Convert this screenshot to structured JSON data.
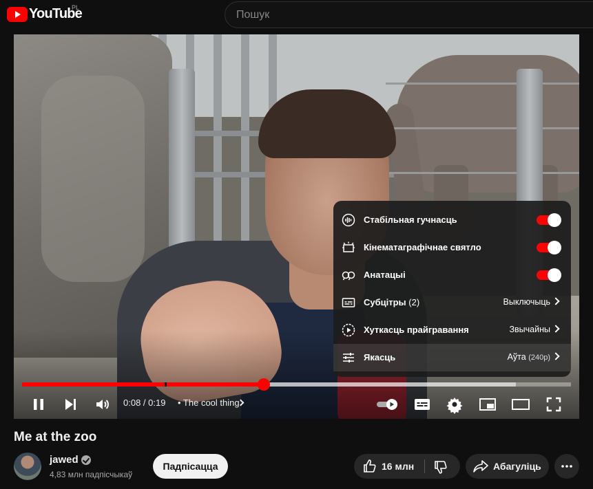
{
  "header": {
    "logo_text": "YouTube",
    "region": "PL",
    "search_placeholder": "Пошук"
  },
  "colors": {
    "accent": "#ff0000",
    "background": "#0f0f0f",
    "chip": "#272727"
  },
  "player": {
    "time_current": "0:08",
    "time_total": "0:19",
    "time_display": "0:08 / 0:19",
    "chapter": "• The cool thing",
    "progress_fraction": 0.44,
    "buffered_fraction": 0.9,
    "settings": {
      "items": [
        {
          "label": "Стабільная гучнасць",
          "type": "toggle",
          "on": true,
          "icon": "stable-volume-icon"
        },
        {
          "label": "Кінематаграфічнае святло",
          "type": "toggle",
          "on": true,
          "icon": "ambient-mode-icon"
        },
        {
          "label": "Анатацыі",
          "type": "toggle",
          "on": true,
          "icon": "annotations-icon"
        },
        {
          "label": "Субцітры",
          "count": "(2)",
          "value": "Выключыць",
          "type": "submenu",
          "icon": "subtitles-icon"
        },
        {
          "label": "Хуткасць прайгравання",
          "value": "Звычайны",
          "type": "submenu",
          "icon": "playback-speed-icon"
        },
        {
          "label": "Якасць",
          "value": "Аўта",
          "value_small": "(240p)",
          "type": "submenu",
          "icon": "quality-icon"
        }
      ]
    }
  },
  "video": {
    "title": "Me at the zoo",
    "channel": "jawed",
    "subscribers": "4,83 млн падпісчыкаў",
    "subscribe_label": "Падпісацца",
    "likes": "16 млн",
    "share_label": "Абагуліць"
  }
}
